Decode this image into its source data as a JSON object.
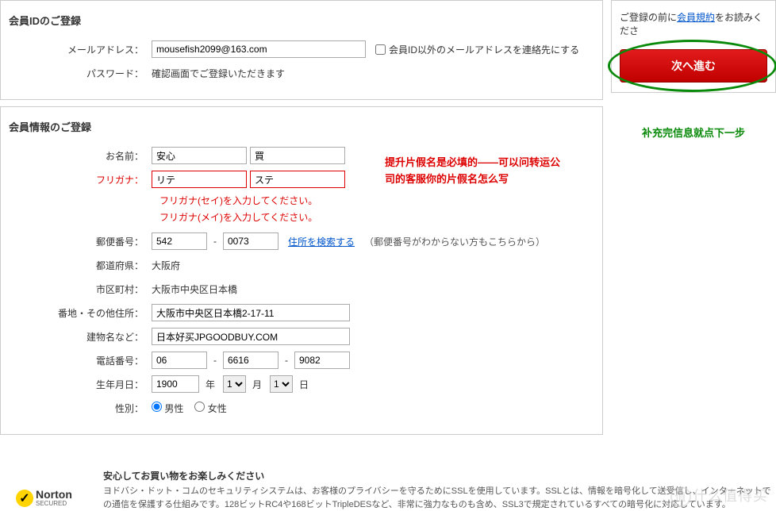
{
  "section1": {
    "title": "会員IDのご登録",
    "email_label": "メールアドレス：",
    "email_value": "mousefish2099@163.com",
    "checkbox_label": "会員ID以外のメールアドレスを連絡先にする",
    "password_label": "パスワード：",
    "password_text": "確認画面でご登録いただきます"
  },
  "section2": {
    "title": "会員情報のご登録",
    "name_label": "お名前：",
    "name_sei": "安心",
    "name_mei": "買",
    "furigana_label": "フリガナ：",
    "furigana_sei": "リテ",
    "furigana_mei": "ステ",
    "err_sei": "フリガナ(セイ)を入力してください。",
    "err_mei": "フリガナ(メイ)を入力してください。",
    "postal_label": "郵便番号：",
    "postal1": "542",
    "postal2": "0073",
    "postal_link": "住所を検索する",
    "postal_hint": "（郵便番号がわからない方もこちらから）",
    "pref_label": "都道府県：",
    "pref_value": "大阪府",
    "city_label": "市区町村：",
    "city_value": "大阪市中央区日本橋",
    "addr_label": "番地・その他住所：",
    "addr_value": "大阪市中央区日本橋2-17-11",
    "building_label": "建物名など：",
    "building_value": "日本好买JPGOODBUY.COM",
    "tel_label": "電話番号：",
    "tel1": "06",
    "tel2": "6616",
    "tel3": "9082",
    "birth_label": "生年月日：",
    "birth_year": "1900",
    "birth_month": "1",
    "birth_day": "1",
    "year_unit": "年",
    "month_unit": "月",
    "day_unit": "日",
    "gender_label": "性別：",
    "gender_male": "男性",
    "gender_female": "女性"
  },
  "annotations": {
    "red_line1": "提升片假名是必填的——可以问转运公",
    "red_line2": "司的客服你的片假名怎么写",
    "green": "补充完信息就点下一步"
  },
  "right": {
    "top_pre": "ご登録の前に",
    "top_link": "会員規約",
    "top_post": "をお読みくださ",
    "button": "次へ進む"
  },
  "footer": {
    "title": "安心してお買い物をお楽しみください",
    "text": "ヨドバシ・ドット・コムのセキュリティシステムは、お客様のプライバシーを守るためにSSLを使用しています。SSLとは、情報を暗号化して送受信し、インターネットでの通信を保護する仕組みです。128ビットRC4や168ビットTripleDESなど、非常に強力なものも含め、SSL3で規定されているすべての暗号化に対応しています。",
    "norton": "Norton",
    "norton_sub": "SECURED"
  },
  "watermark": "值 什么值得买"
}
